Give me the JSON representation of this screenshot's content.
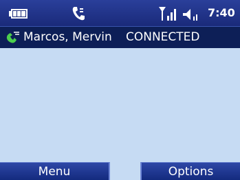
{
  "status_bar": {
    "icons": [
      "battery-icon",
      "call-active-icon",
      "signal-icon",
      "volume-icon"
    ],
    "time": "7:40"
  },
  "active_call": {
    "icon": "phone-call-icon",
    "caller_name": "Marcos, Mervin",
    "status": "CONNECTED"
  },
  "softkeys": {
    "left_label": "Menu",
    "right_label": "Options"
  },
  "colors": {
    "status_bar_bg": "#1a2a7a",
    "call_row_bg": "#0d1f57",
    "content_bg": "#c6dbf3",
    "softkey_bg": "#1f3590",
    "text": "#ffffff"
  }
}
